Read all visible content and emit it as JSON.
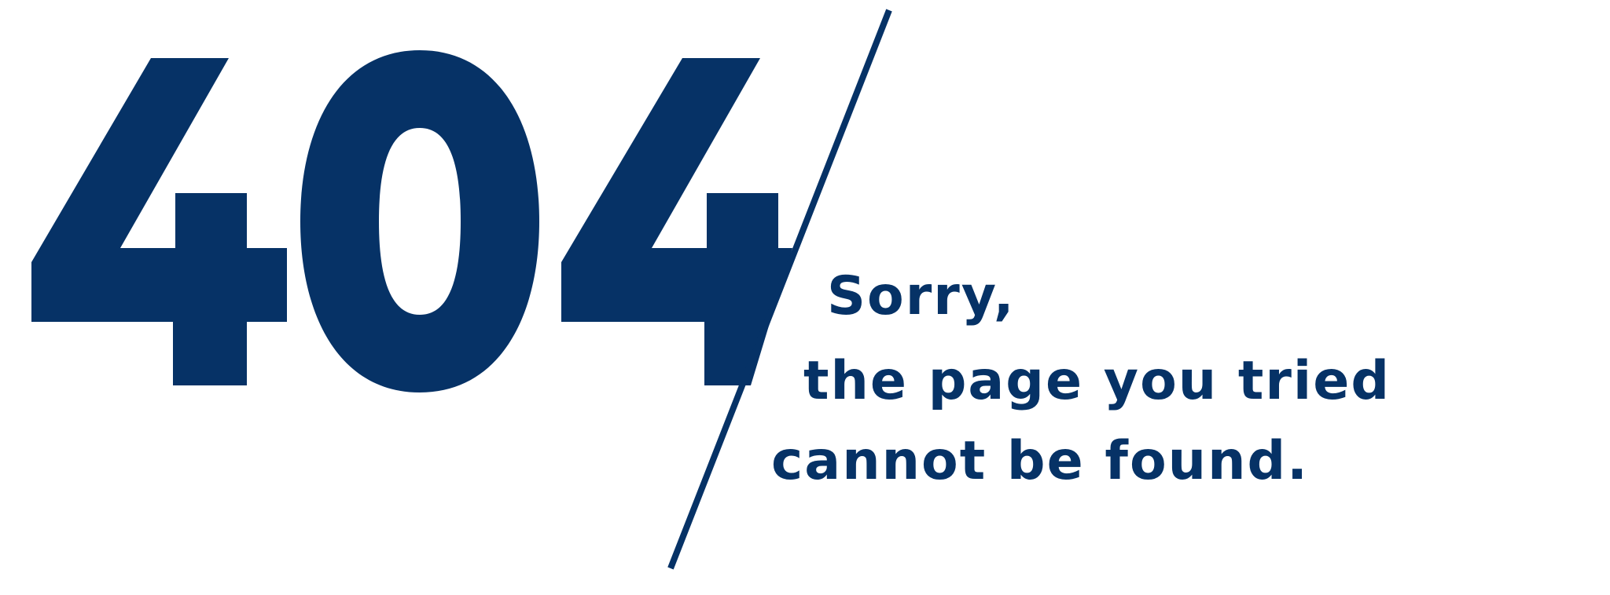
{
  "error_code": {
    "digits": [
      "4",
      "0",
      "4"
    ]
  },
  "message": {
    "line1": "Sorry,",
    "line2": "the page you tried",
    "line3": "cannot be found."
  },
  "colors": {
    "primary": "#063266",
    "background": "#ffffff"
  }
}
